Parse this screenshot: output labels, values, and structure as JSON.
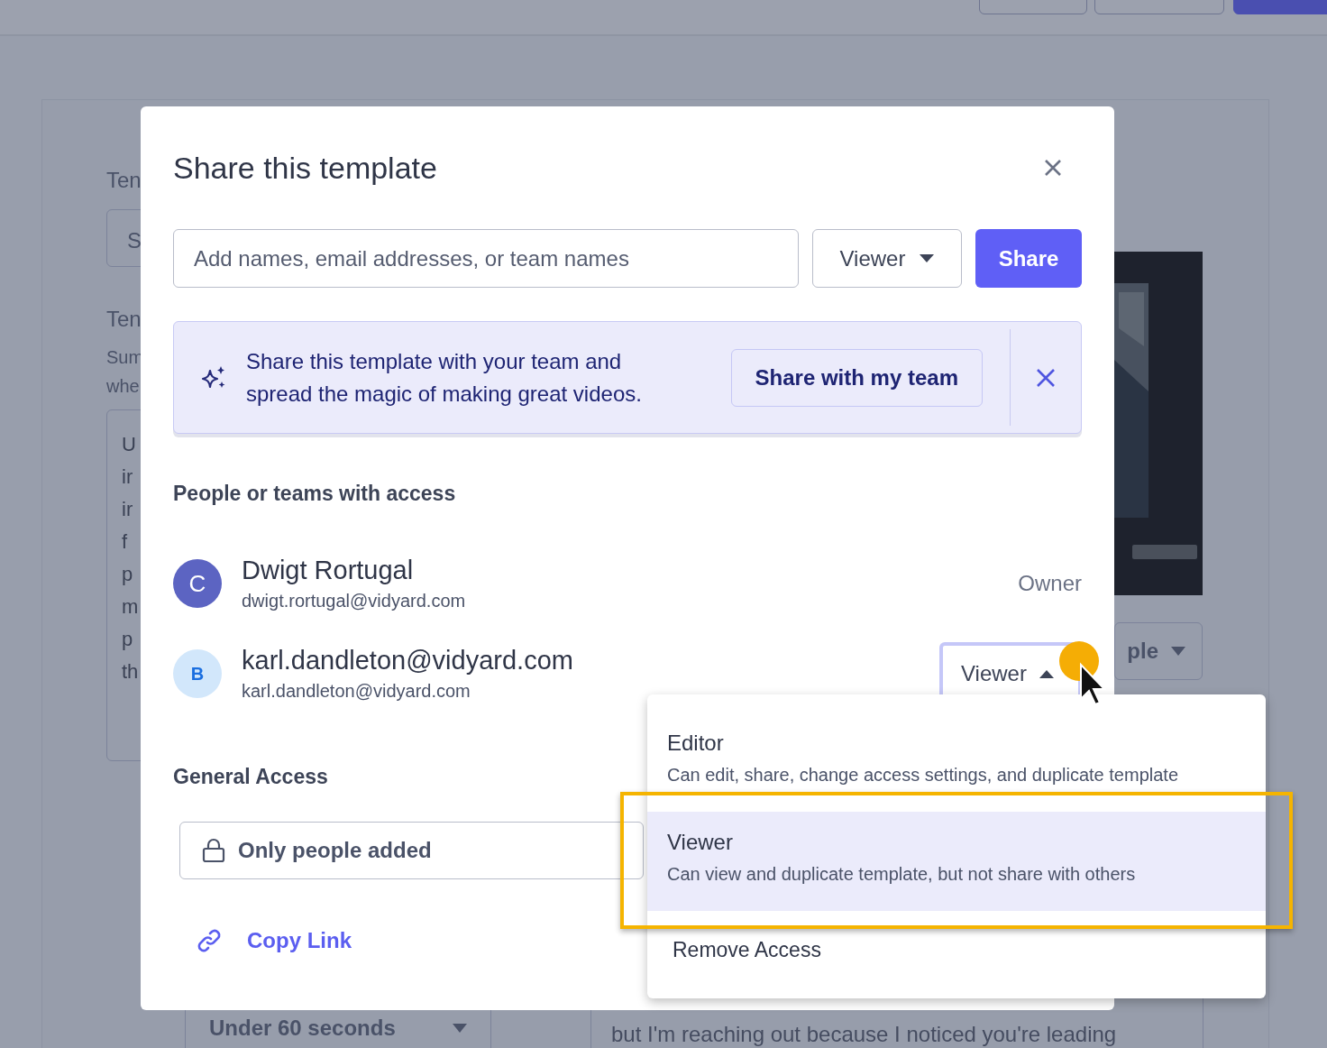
{
  "backdrop": {
    "labels": [
      "Ten",
      "Ten"
    ],
    "field_value": "S",
    "hint_lines": [
      "Sum",
      "whe"
    ],
    "textarea_lines": [
      "U",
      "ir",
      "ir",
      "f",
      "p",
      "m",
      "p",
      "th"
    ],
    "duration_select": "Under 60 seconds",
    "right_select": "ple",
    "message_line": "but I'm reaching out because I noticed you're leading"
  },
  "dialog": {
    "title": "Share this template",
    "input_placeholder": "Add names, email addresses, or team names",
    "role_select": "Viewer",
    "share_button": "Share",
    "banner": {
      "text": "Share this template with your team and spread the magic of making great videos.",
      "button": "Share with my team"
    },
    "access_heading": "People or teams with access",
    "people": [
      {
        "kind": "owner",
        "initial": "C",
        "color": "#5c64c2",
        "name": "Dwigt Rortugal",
        "email": "dwigt.rortugal@vidyard.com",
        "role": "Owner"
      },
      {
        "kind": "member",
        "initial": "B",
        "color": "#d2e7fb",
        "name": "karl.dandleton@vidyard.com",
        "email": "karl.dandleton@vidyard.com",
        "role": "Viewer",
        "expanded": true
      }
    ],
    "general_heading": "General Access",
    "general_value": "Only people added",
    "copy_link": "Copy Link"
  },
  "menu": {
    "options": [
      {
        "title": "Editor",
        "description": "Can edit, share, change access settings, and duplicate template",
        "selected": false
      },
      {
        "title": "Viewer",
        "description": "Can view and duplicate template, but not share with others",
        "selected": true
      }
    ],
    "remove": "Remove Access"
  }
}
